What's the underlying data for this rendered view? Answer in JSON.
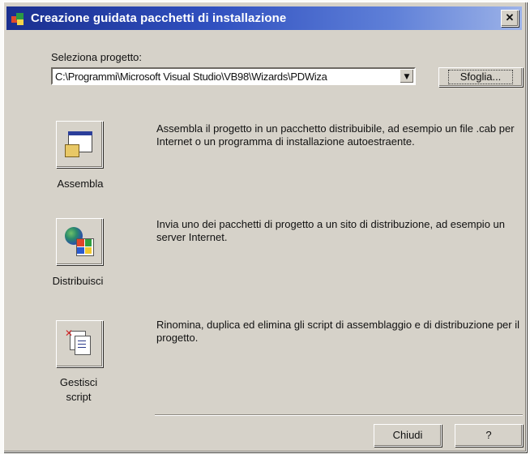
{
  "window": {
    "title": "Creazione guidata pacchetti di installazione",
    "close_glyph": "✕"
  },
  "project": {
    "label": "Seleziona progetto:",
    "path": "C:\\Programmi\\Microsoft Visual Studio\\VB98\\Wizards\\PDWiza",
    "dropdown_glyph": "▼",
    "browse_label": "Sfoglia..."
  },
  "actions": [
    {
      "id": "assembla",
      "label": "Assembla",
      "icon": "package-icon",
      "description": "Assembla il progetto in un pacchetto distribuibile, ad esempio un file .cab per Internet o un programma di installazione autoestraente."
    },
    {
      "id": "distribuisci",
      "label": "Distribuisci",
      "icon": "globe-windows-icon",
      "description": "Invia uno dei pacchetti di progetto a un sito di distribuzione, ad esempio un server Internet."
    },
    {
      "id": "gestisci",
      "label_line1": "Gestisci",
      "label_line2": "script",
      "icon": "scripts-icon",
      "description": "Rinomina, duplica ed elimina gli script di assemblaggio e di distribuzione per il progetto."
    }
  ],
  "footer": {
    "close_label": "Chiudi",
    "help_label": "?"
  },
  "colors": {
    "titlebar_start": "#1a2f8f",
    "titlebar_end": "#9db3e8",
    "dialog_bg": "#d6d2c9"
  }
}
